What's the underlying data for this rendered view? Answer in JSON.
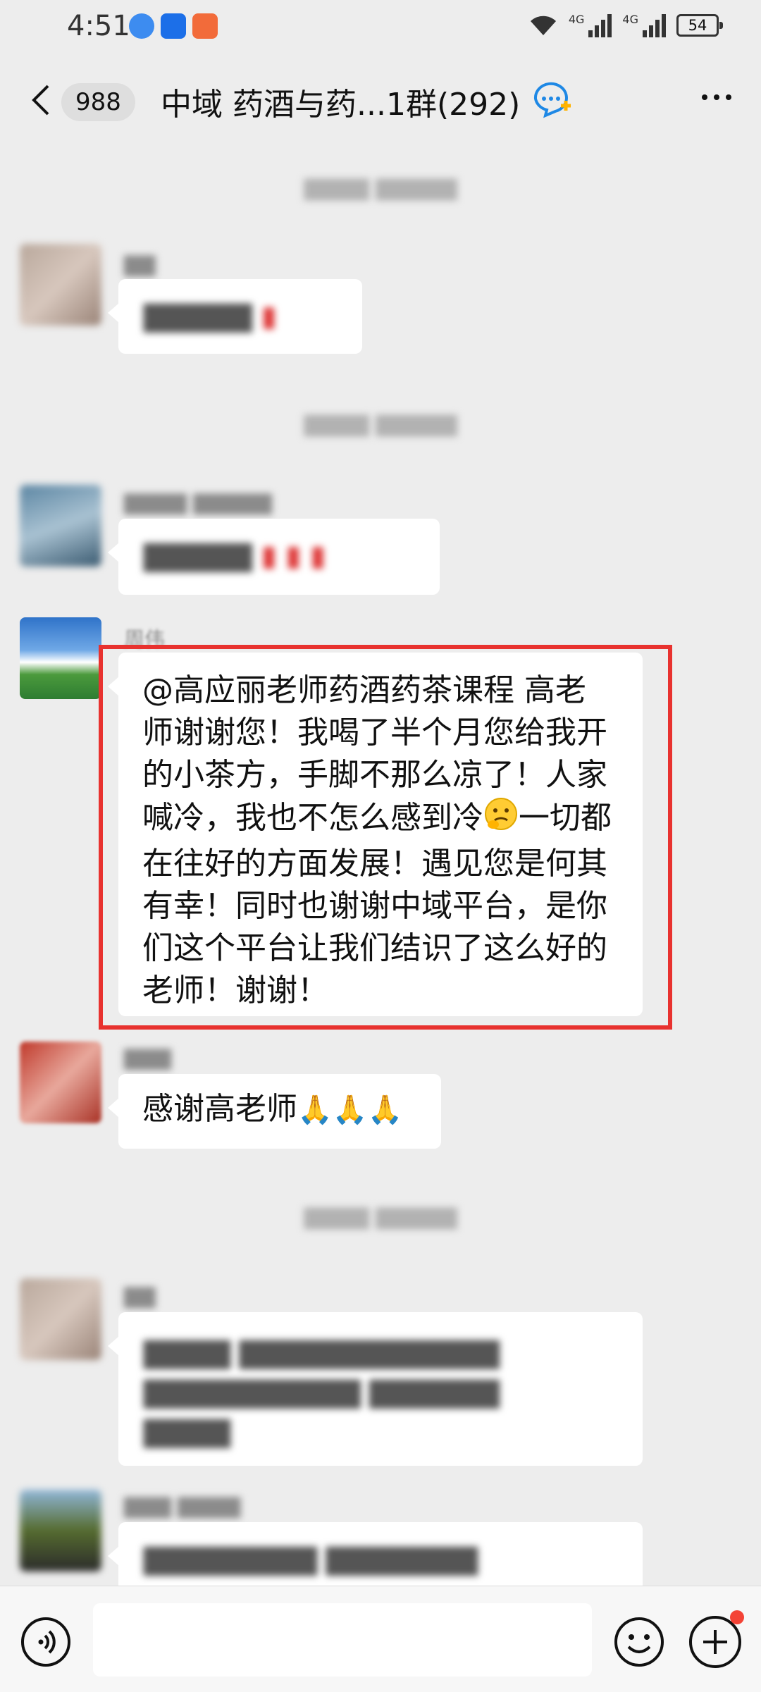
{
  "status_bar": {
    "time": "4:51",
    "battery": "54",
    "net1": "4G",
    "net2": "4G"
  },
  "header": {
    "unread_count": "988",
    "title": "中域 药酒与药...1群(292)"
  },
  "highlighted_message": {
    "sender": "周伟",
    "lines": [
      "@高应丽老师药酒药茶课程  高老",
      "师谢谢您！我喝了半个月您给我开",
      "的小茶方，手脚不那么凉了！人家",
      "喊冷，我也不怎么感到冷",
      "一切都",
      "在往好的方面发展！遇见您是何其",
      "有幸！同时也谢谢中域平台，是你",
      "们这个平台让我们结识了这么好的",
      "老师！谢谢！"
    ]
  },
  "message_2": {
    "text": "感谢高老师"
  },
  "colors": {
    "highlight": "#e8322f",
    "background": "#ededed",
    "bubble": "#ffffff"
  },
  "icons": [
    "back-arrow-icon",
    "group-chat-icon",
    "more-dots-icon",
    "voice-icon",
    "emoji-icon",
    "plus-icon",
    "pray-emoji-icon",
    "thinking-emoji-icon"
  ]
}
